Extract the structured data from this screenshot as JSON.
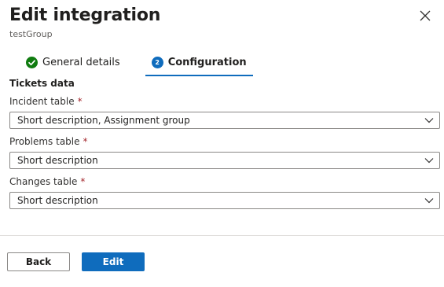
{
  "header": {
    "title": "Edit integration",
    "subtitle": "testGroup"
  },
  "tabs": [
    {
      "label": "General details",
      "status": "completed",
      "icon": "check-circle-icon"
    },
    {
      "label": "Configuration",
      "step": "2",
      "status": "active"
    }
  ],
  "section": {
    "title": "Tickets data"
  },
  "fields": {
    "incident": {
      "label": "Incident table",
      "required_mark": "*",
      "value": "Short description, Assignment group"
    },
    "problems": {
      "label": "Problems table",
      "required_mark": "*",
      "value": "Short description"
    },
    "changes": {
      "label": "Changes table",
      "required_mark": "*",
      "value": "Short description"
    }
  },
  "footer": {
    "back_label": "Back",
    "edit_label": "Edit"
  },
  "colors": {
    "accent": "#0f6cbd",
    "success": "#107c10",
    "required": "#a4262c"
  }
}
